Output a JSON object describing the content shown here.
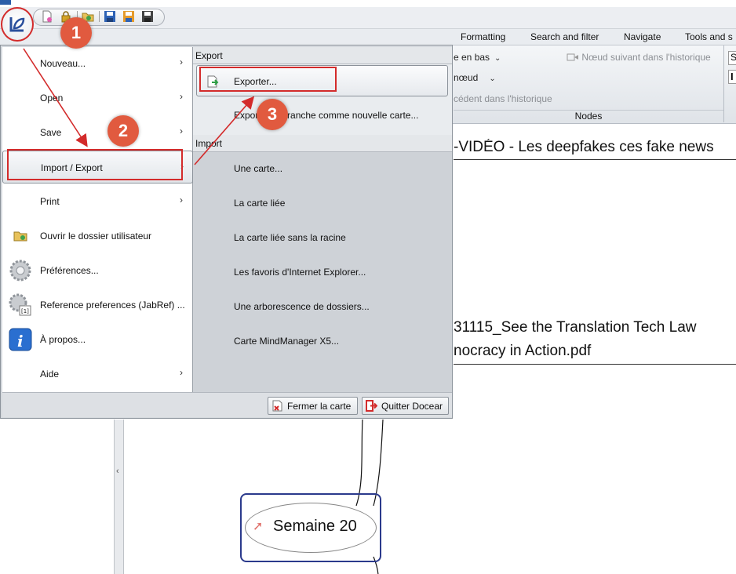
{
  "titlebar": {
    "title": ""
  },
  "ribbon": {
    "tabs": [
      "Formatting",
      "Search and filter",
      "Navigate",
      "Tools and s"
    ],
    "items": {
      "move_down": "e en bas",
      "next_node_history": "Nœud suivant dans l'historique",
      "node": "nœud",
      "prev_history": "cédent dans l'historique",
      "right_cut": "S"
    },
    "group_label": "Nodes"
  },
  "map": {
    "line1": "-VIDÉO - Les deepfakes ces fake news",
    "line2": "31115_See the Translation Tech Law",
    "line3": "nocracy in Action.pdf",
    "node_label": "Semaine 20"
  },
  "menu": {
    "left": [
      {
        "label": "Nouveau...",
        "icon": "",
        "arrow": "›"
      },
      {
        "label": "Open",
        "icon": "",
        "arrow": "›"
      },
      {
        "label": "Save",
        "icon": "",
        "arrow": "›"
      },
      {
        "label": "Import / Export",
        "icon": "",
        "arrow": "›"
      },
      {
        "label": "Print",
        "icon": "",
        "arrow": "›"
      },
      {
        "label": "Ouvrir le dossier utilisateur",
        "icon": "folder-icon",
        "arrow": ""
      },
      {
        "label": "Préférences...",
        "icon": "gear-icon",
        "arrow": ""
      },
      {
        "label": "Reference preferences (JabRef) ...",
        "icon": "gear-reference-icon",
        "arrow": ""
      },
      {
        "label": "À propos...",
        "icon": "info-icon",
        "arrow": ""
      },
      {
        "label": "Aide",
        "icon": "",
        "arrow": "›"
      }
    ],
    "export_header": "Export",
    "export_items": [
      "Exporter...",
      "Exporter la branche comme nouvelle carte..."
    ],
    "import_header": "Import",
    "import_items": [
      "Une carte...",
      "La carte liée",
      "La carte liée sans la racine",
      "Les favoris d'Internet Explorer...",
      "Une arborescence de dossiers...",
      "Carte MindManager X5..."
    ],
    "close_map": "Fermer la carte",
    "quit": "Quitter Docear"
  },
  "annotations": {
    "step1": "1",
    "step2": "2",
    "step3": "3",
    "color": "#d32b2b"
  },
  "colors": {
    "accent_red": "#d32b2b",
    "callout": "#e15a3f",
    "node_border": "#2b3a8c"
  }
}
